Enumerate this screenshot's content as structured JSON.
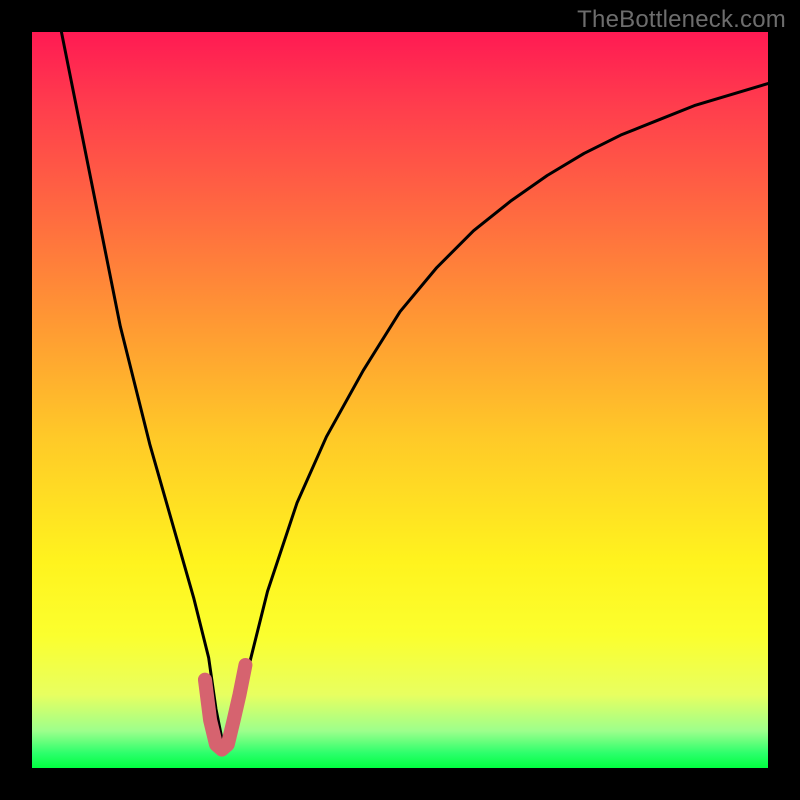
{
  "watermark": "TheBottleneck.com",
  "colors": {
    "bg": "#000000",
    "gradient_top": "#ff1a53",
    "gradient_bottom": "#00ff40",
    "curve_stroke": "#000000",
    "highlight_stroke": "#d6636f"
  },
  "chart_data": {
    "type": "line",
    "title": "",
    "xlabel": "",
    "ylabel": "",
    "xlim": [
      0,
      100
    ],
    "ylim": [
      0,
      100
    ],
    "annotations": [],
    "series": [
      {
        "name": "bottleneck-curve",
        "x": [
          4,
          6,
          8,
          10,
          12,
          14,
          16,
          18,
          20,
          22,
          24,
          25,
          26,
          27,
          28,
          30,
          32,
          36,
          40,
          45,
          50,
          55,
          60,
          65,
          70,
          75,
          80,
          85,
          90,
          95,
          100
        ],
        "y": [
          100,
          90,
          80,
          70,
          60,
          52,
          44,
          37,
          30,
          23,
          15,
          8,
          3,
          3,
          8,
          16,
          24,
          36,
          45,
          54,
          62,
          68,
          73,
          77,
          80.5,
          83.5,
          86,
          88,
          90,
          91.5,
          93
        ]
      }
    ],
    "highlight_region": {
      "x": [
        23.5,
        24.2,
        25.0,
        25.8,
        26.6,
        27.4,
        28.2,
        29.0
      ],
      "y": [
        12.0,
        6.5,
        3.2,
        2.5,
        3.2,
        6.5,
        10.0,
        14.0
      ]
    }
  }
}
